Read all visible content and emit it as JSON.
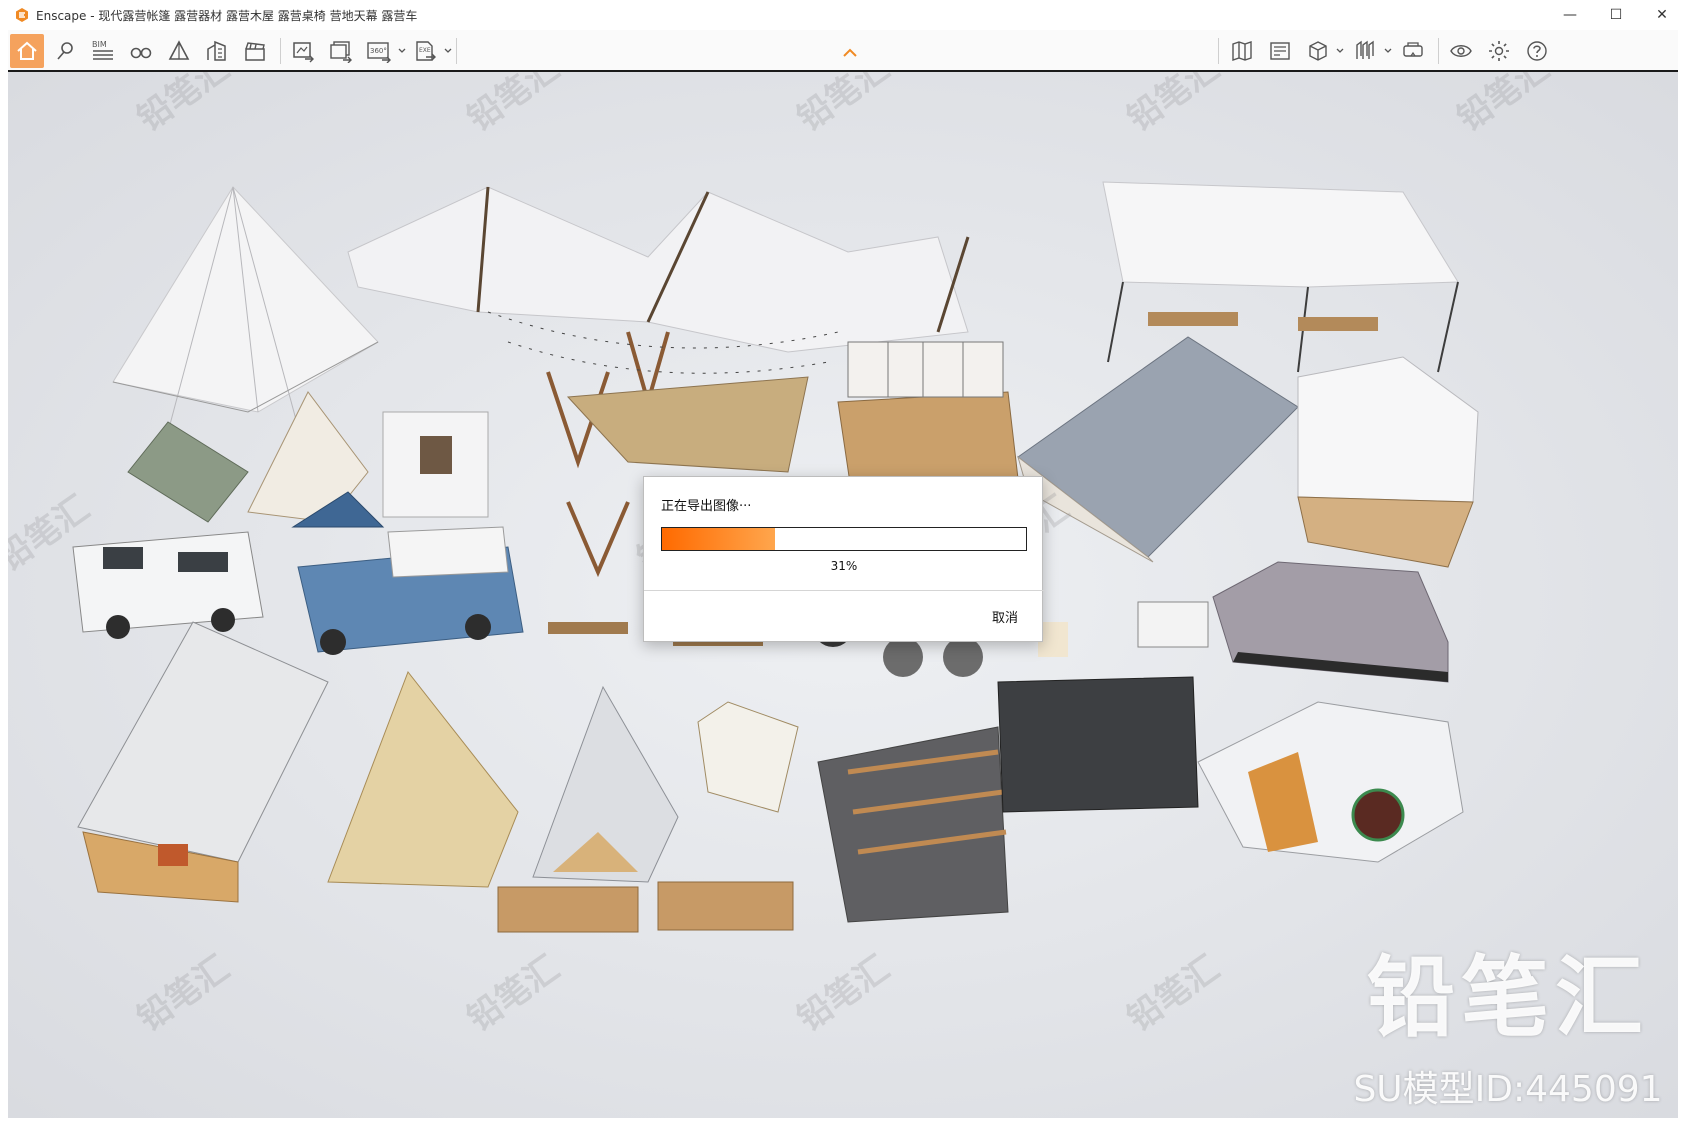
{
  "window": {
    "app_name": "Enscape",
    "title": "Enscape - 现代露营帐篷 露营器材 露营木屋 露营桌椅 营地天幕 露营车",
    "controls": {
      "minimize": "—",
      "maximize": "☐",
      "close": "✕"
    }
  },
  "toolbar": {
    "accent_color": "#f5a25d",
    "left_tools": [
      {
        "name": "home-icon",
        "active": true
      },
      {
        "name": "location-pin-icon"
      },
      {
        "name": "bim-icon",
        "label": "BIM"
      },
      {
        "name": "binoculars-icon"
      },
      {
        "name": "perspective-icon"
      },
      {
        "name": "buildings-icon"
      },
      {
        "name": "clapperboard-icon"
      },
      {
        "name": "screenshot-export-icon"
      },
      {
        "name": "batch-export-icon"
      },
      {
        "name": "panorama-360-icon",
        "label": "360°"
      },
      {
        "name": "exe-export-icon",
        "label": "EXE"
      }
    ],
    "right_tools": [
      {
        "name": "map-icon"
      },
      {
        "name": "asset-library-icon"
      },
      {
        "name": "cube-icon"
      },
      {
        "name": "material-icon"
      },
      {
        "name": "vr-headset-icon"
      },
      {
        "name": "eye-icon"
      },
      {
        "name": "settings-gear-icon"
      },
      {
        "name": "help-icon"
      }
    ]
  },
  "watermark": {
    "brand": "铅笔汇",
    "model_id": "SU模型ID:445091"
  },
  "export_dialog": {
    "title": "正在导出图像···",
    "progress": 0.31,
    "progress_label": "31%",
    "cancel_label": "取消"
  }
}
